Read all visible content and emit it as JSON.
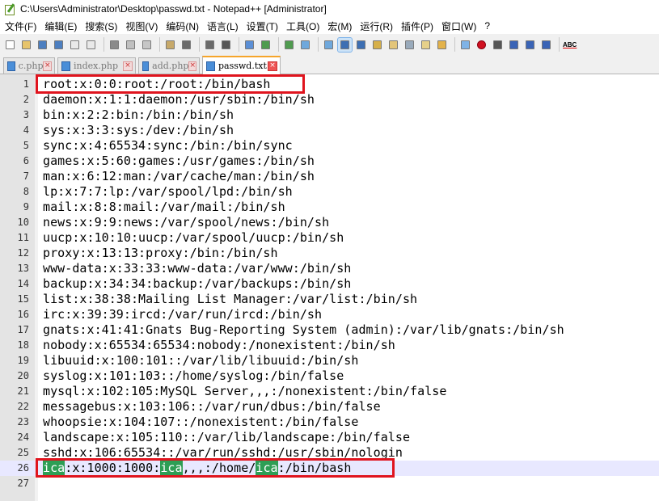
{
  "window": {
    "title": "C:\\Users\\Administrator\\Desktop\\passwd.txt - Notepad++ [Administrator]"
  },
  "menu": [
    "文件(F)",
    "编辑(E)",
    "搜索(S)",
    "视图(V)",
    "编码(N)",
    "语言(L)",
    "设置(T)",
    "工具(O)",
    "宏(M)",
    "运行(R)",
    "插件(P)",
    "窗口(W)",
    "?"
  ],
  "toolbar": {
    "icons": [
      "new-file-icon",
      "open-file-icon",
      "save-icon",
      "save-all-icon",
      "close-icon",
      "close-all-icon",
      "print-icon",
      "cut-icon",
      "copy-icon",
      "paste-icon",
      "undo-icon",
      "redo-icon",
      "find-icon",
      "replace-icon",
      "zoom-in-icon",
      "zoom-out-icon",
      "sync-vertical-icon",
      "sync-horizontal-icon",
      "word-wrap-icon",
      "show-all-chars-icon",
      "indent-guide-icon",
      "user-lang-icon",
      "doc-map-icon",
      "function-list-icon",
      "folder-as-workspace-icon",
      "monitoring-icon",
      "record-macro-icon",
      "stop-record-icon",
      "play-macro-icon",
      "run-macro-multiple-icon",
      "save-macro-icon",
      "spellcheck-icon"
    ],
    "spellcheck_label": "ABC"
  },
  "tabs": [
    {
      "label": "c.php",
      "active": false
    },
    {
      "label": "index.php",
      "active": false
    },
    {
      "label": "add.php",
      "active": false
    },
    {
      "label": "passwd.txt",
      "active": true
    }
  ],
  "colors": {
    "annotation": "#e0141e",
    "highlight": "#2e9e55",
    "current_line": "#e8e8ff"
  },
  "editor": {
    "current_line": 26,
    "lines": [
      {
        "n": "1",
        "text": "root:x:0:0:root:/root:/bin/bash"
      },
      {
        "n": "2",
        "text": "daemon:x:1:1:daemon:/usr/sbin:/bin/sh"
      },
      {
        "n": "3",
        "text": "bin:x:2:2:bin:/bin:/bin/sh"
      },
      {
        "n": "4",
        "text": "sys:x:3:3:sys:/dev:/bin/sh"
      },
      {
        "n": "5",
        "text": "sync:x:4:65534:sync:/bin:/bin/sync"
      },
      {
        "n": "6",
        "text": "games:x:5:60:games:/usr/games:/bin/sh"
      },
      {
        "n": "7",
        "text": "man:x:6:12:man:/var/cache/man:/bin/sh"
      },
      {
        "n": "8",
        "text": "lp:x:7:7:lp:/var/spool/lpd:/bin/sh"
      },
      {
        "n": "9",
        "text": "mail:x:8:8:mail:/var/mail:/bin/sh"
      },
      {
        "n": "10",
        "text": "news:x:9:9:news:/var/spool/news:/bin/sh"
      },
      {
        "n": "11",
        "text": "uucp:x:10:10:uucp:/var/spool/uucp:/bin/sh"
      },
      {
        "n": "12",
        "text": "proxy:x:13:13:proxy:/bin:/bin/sh"
      },
      {
        "n": "13",
        "text": "www-data:x:33:33:www-data:/var/www:/bin/sh"
      },
      {
        "n": "14",
        "text": "backup:x:34:34:backup:/var/backups:/bin/sh"
      },
      {
        "n": "15",
        "text": "list:x:38:38:Mailing List Manager:/var/list:/bin/sh"
      },
      {
        "n": "16",
        "text": "irc:x:39:39:ircd:/var/run/ircd:/bin/sh"
      },
      {
        "n": "17",
        "text": "gnats:x:41:41:Gnats Bug-Reporting System (admin):/var/lib/gnats:/bin/sh"
      },
      {
        "n": "18",
        "text": "nobody:x:65534:65534:nobody:/nonexistent:/bin/sh"
      },
      {
        "n": "19",
        "text": "libuuid:x:100:101::/var/lib/libuuid:/bin/sh"
      },
      {
        "n": "20",
        "text": "syslog:x:101:103::/home/syslog:/bin/false"
      },
      {
        "n": "21",
        "text": "mysql:x:102:105:MySQL Server,,,:/nonexistent:/bin/false"
      },
      {
        "n": "22",
        "text": "messagebus:x:103:106::/var/run/dbus:/bin/false"
      },
      {
        "n": "23",
        "text": "whoopsie:x:104:107::/nonexistent:/bin/false"
      },
      {
        "n": "24",
        "text": "landscape:x:105:110::/var/lib/landscape:/bin/false"
      },
      {
        "n": "25",
        "text": "sshd:x:106:65534::/var/run/sshd:/usr/sbin/nologin"
      },
      {
        "n": "26",
        "segments": [
          {
            "t": "ica",
            "hl": true
          },
          {
            "t": ":x:1000:1000:",
            "hl": false
          },
          {
            "t": "ica",
            "hl": true
          },
          {
            "t": ",,,:/home/",
            "hl": false
          },
          {
            "t": "ica",
            "hl": true
          },
          {
            "t": ":/bin/bash",
            "hl": false
          }
        ]
      },
      {
        "n": "27",
        "text": ""
      }
    ]
  }
}
